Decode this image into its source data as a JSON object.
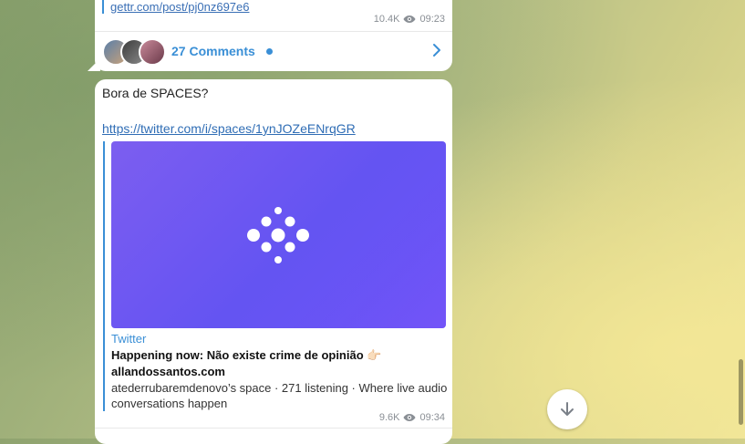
{
  "post1": {
    "link": "gettr.com/post/pj0nz697e6",
    "views": "10.4K",
    "time": "09:23",
    "comments_label": "27 Comments"
  },
  "post2": {
    "text": "Bora de SPACES?",
    "link": "https://twitter.com/i/spaces/1ynJOZeENrqGR",
    "preview": {
      "site": "Twitter",
      "title": "Happening now: Não existe crime de opinião 👉🏻 allandossantos.com",
      "description": "atederrubaremdenovo’s space · 271 listening · Where live audio conversations happen"
    },
    "views": "9.6K",
    "time": "09:34"
  },
  "icons": {
    "views": "eye-icon",
    "chevron": "chevron-right-icon",
    "scroll": "arrow-down-icon"
  },
  "colors": {
    "accent": "#3a8fd6",
    "preview_gradient_start": "#7c5ef0",
    "preview_gradient_end": "#4f4ff2"
  }
}
